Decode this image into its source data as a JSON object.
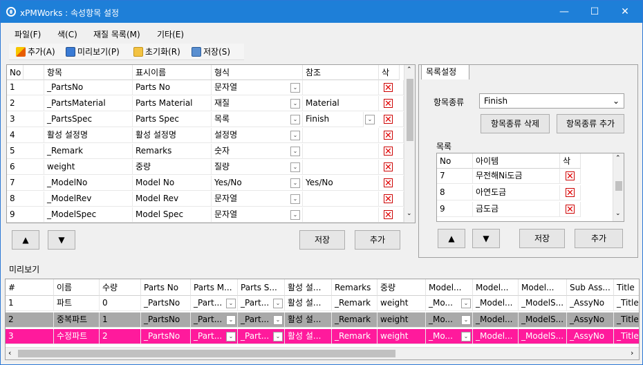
{
  "window": {
    "title": "xPMWorks : 속성항목 설정",
    "minimize": "—",
    "maximize": "☐",
    "close": "✕"
  },
  "menu": [
    "파일(F)",
    "색(C)",
    "재질 목록(M)",
    "기타(E)"
  ],
  "toolbar": {
    "add": "추가(A)",
    "preview": "미리보기(P)",
    "reset": "초기화(R)",
    "save": "저장(S)"
  },
  "fields_grid": {
    "headers": [
      "No",
      "항목",
      "표시이름",
      "형식",
      "참조",
      "삭"
    ],
    "rows": [
      {
        "no": "1",
        "item": "_PartsNo",
        "display": "Parts No",
        "type": "문자열",
        "ref": ""
      },
      {
        "no": "2",
        "item": "_PartsMaterial",
        "display": "Parts Material",
        "type": "재질",
        "ref": "Material"
      },
      {
        "no": "3",
        "item": "_PartsSpec",
        "display": "Parts Spec",
        "type": "목록",
        "ref": "Finish"
      },
      {
        "no": "4",
        "item": "활성 설정명",
        "display": "활성 설정명",
        "type": "설정명",
        "ref": ""
      },
      {
        "no": "5",
        "item": "_Remark",
        "display": "Remarks",
        "type": "숫자",
        "ref": ""
      },
      {
        "no": "6",
        "item": "weight",
        "display": "중량",
        "type": "질량",
        "ref": ""
      },
      {
        "no": "7",
        "item": "_ModelNo",
        "display": "Model No",
        "type": "Yes/No",
        "ref": "Yes/No"
      },
      {
        "no": "8",
        "item": "_ModelRev",
        "display": "Model Rev",
        "type": "문자열",
        "ref": ""
      },
      {
        "no": "9",
        "item": "_ModelSpec",
        "display": "Model Spec",
        "type": "문자열",
        "ref": ""
      }
    ]
  },
  "left_buttons": {
    "up": "▲",
    "down": "▼",
    "save": "저장",
    "add": "추가"
  },
  "list_settings": {
    "tab": "목록설정",
    "category_label": "항목종류",
    "category_value": "Finish",
    "delete_category": "항목종류 삭제",
    "add_category": "항목종류 추가",
    "list_label": "목록",
    "headers": [
      "No",
      "아이템",
      "삭"
    ],
    "rows": [
      {
        "no": "7",
        "item": "무전해Ni도금"
      },
      {
        "no": "8",
        "item": "아연도금"
      },
      {
        "no": "9",
        "item": "금도금"
      }
    ],
    "up": "▲",
    "down": "▼",
    "save": "저장",
    "add": "추가"
  },
  "preview": {
    "label": "미리보기",
    "headers": [
      "#",
      "이름",
      "수량",
      "Parts No",
      "Parts M...",
      "Parts S...",
      "활성 설...",
      "Remarks",
      "중량",
      "Model...",
      "Model...",
      "Model...",
      "Sub Ass...",
      "Title"
    ],
    "rows": [
      {
        "cells": [
          "1",
          "파트",
          "0",
          "_PartsNo",
          "_Part...",
          "_Part...",
          "활성 설...",
          "_Remark",
          "weight",
          "_Mo...",
          "_Model...",
          "_ModelS...",
          "_AssyNo",
          "_Title"
        ],
        "style": "normal"
      },
      {
        "cells": [
          "2",
          "중복파트",
          "1",
          "_PartsNo",
          "_Part...",
          "_Part...",
          "활성 설...",
          "_Remark",
          "weight",
          "_Mo...",
          "_Model...",
          "_ModelS...",
          "_AssyNo",
          "_Title"
        ],
        "style": "gray"
      },
      {
        "cells": [
          "3",
          "수정파트",
          "2",
          "_PartsNo",
          "_Part...",
          "_Part...",
          "활성 설...",
          "_Remark",
          "weight",
          "_Mo...",
          "_Model...",
          "_ModelS...",
          "_AssyNo",
          "_Title"
        ],
        "style": "pink"
      }
    ]
  },
  "colors": {
    "titlebar": "#1e7fd8",
    "gray_row": "#a9a9a9",
    "pink_row": "#ff1a9c",
    "delete": "#e10000"
  }
}
